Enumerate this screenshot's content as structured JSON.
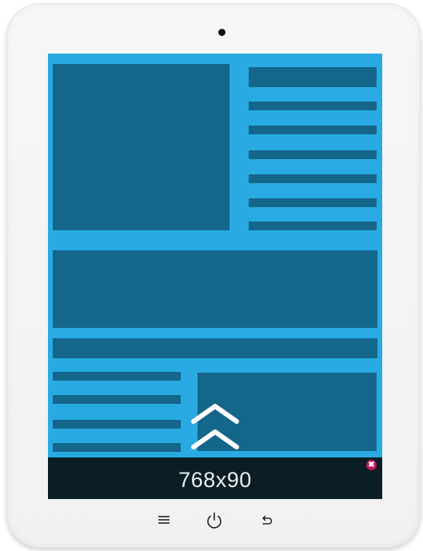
{
  "ad": {
    "size_label": "768x90",
    "close_glyph": "✖"
  },
  "colors": {
    "screen_bg": "#29aae3",
    "content_block": "#14668a",
    "ad_bg": "#0b1e25",
    "close_button": "#c2185b"
  },
  "device": {
    "hardware_buttons": [
      "menu-icon",
      "power-icon",
      "back-icon"
    ]
  }
}
